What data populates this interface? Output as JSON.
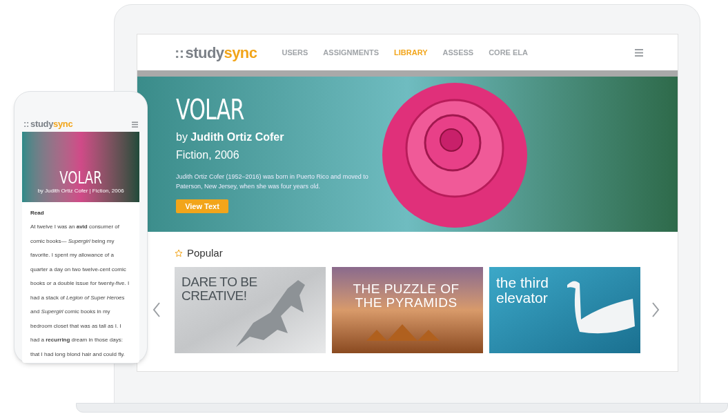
{
  "laptop": {
    "logo": {
      "dots": "::",
      "study": "study",
      "sync": "sync"
    },
    "nav": [
      {
        "label": "USERS",
        "selected": false
      },
      {
        "label": "ASSIGNMENTS",
        "selected": false
      },
      {
        "label": "LIBRARY",
        "selected": true
      },
      {
        "label": "ASSESS",
        "selected": false
      },
      {
        "label": "CORE ELA",
        "selected": false
      }
    ],
    "hero": {
      "title": "VOLAR",
      "author_prefix": "by",
      "author": "Judith Ortiz Cofer",
      "genre": "Fiction, 2006",
      "bio": "Judith Ortiz Cofer (1952–2016) was born in Puerto Rico and moved to Paterson, New Jersey, when she was four years old.",
      "button": "View Text"
    },
    "popular": {
      "heading": "Popular",
      "cards": [
        {
          "kind": "horse",
          "title": "DARE TO BE CREATIVE!"
        },
        {
          "kind": "pyramids",
          "title": "THE PUZZLE OF THE PYRAMIDS"
        },
        {
          "kind": "swan",
          "title": "the third elevator"
        }
      ]
    }
  },
  "phone": {
    "logo": {
      "dots": "::",
      "study": "study",
      "sync": "sync"
    },
    "hero": {
      "title": "VOLAR",
      "subtitle": "by Judith Ortiz Cofer | Fiction, 2006"
    },
    "section": "Read",
    "text": "At twelve I was an **avid** consumer of comic books— *Supergirl* being my favorite. I spent my allowance of a quarter a day on two twelve-cent comic books or a double issue for twenty-five. I had a stack of *Legion of Super Heroes* and *Supergirl* comic books in my bedroom closet that was as tall as I. I had a **recurring** dream in those days: that I had long blond hair and could fly."
  }
}
